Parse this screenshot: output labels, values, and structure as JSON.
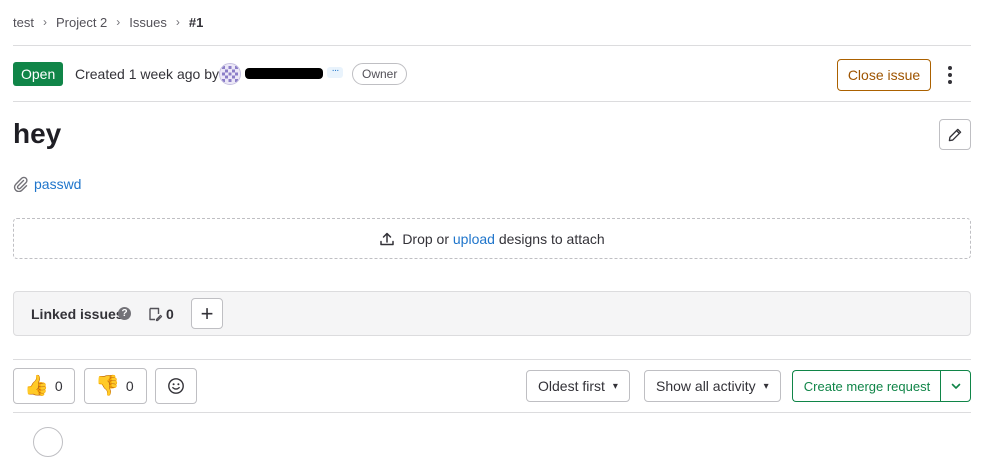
{
  "breadcrumb": {
    "items": [
      "test",
      "Project 2",
      "Issues",
      "#1"
    ],
    "separator": "›"
  },
  "header": {
    "status": "Open",
    "created_text": "Created 1 week ago by",
    "more_badge": "···",
    "role_badge": "Owner",
    "close_label": "Close issue"
  },
  "issue": {
    "title": "hey",
    "attachment": "passwd"
  },
  "designs": {
    "prefix": "Drop or",
    "link": "upload",
    "suffix": "designs to attach"
  },
  "linked_issues": {
    "title": "Linked issues",
    "help": "?",
    "count": "0",
    "add": "+"
  },
  "reactions": {
    "thumbs_up": {
      "emoji": "👍",
      "count": "0"
    },
    "thumbs_down": {
      "emoji": "👎",
      "count": "0"
    }
  },
  "activity": {
    "sort_label": "Oldest first",
    "filter_label": "Show all activity",
    "merge_request_label": "Create merge request"
  },
  "colors": {
    "status_open": "#108548",
    "close_button": "#ab6100",
    "link": "#1f75cb",
    "merge_request": "#108548"
  }
}
